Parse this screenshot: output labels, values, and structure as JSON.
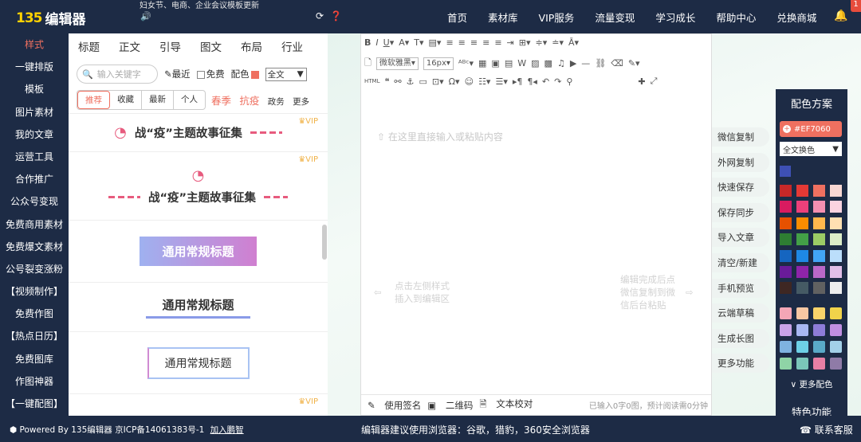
{
  "header": {
    "logo_mark": "135",
    "logo_name": "编辑器",
    "marquee": "妇女节、电商、企业会议模板更新",
    "nav": [
      "首页",
      "素材库",
      "VIP服务",
      "流量变现",
      "学习成长",
      "帮助中心",
      "兑换商城"
    ],
    "notification_count": "1"
  },
  "sidebar": {
    "items": [
      "样式",
      "一键排版",
      "模板",
      "图片素材",
      "我的文章",
      "运营工具",
      "合作推广",
      "公众号变现",
      "免费商用素材",
      "免费爆文素材",
      "公号裂变涨粉",
      "【视频制作】",
      "免费作图",
      "【热点日历】",
      "免费图库",
      "作图神器",
      "【一键配图】"
    ]
  },
  "style_panel": {
    "tabs": [
      "标题",
      "正文",
      "引导",
      "图文",
      "布局",
      "行业"
    ],
    "search_placeholder": "输入关键字",
    "recent_label": "最近",
    "free_label": "免费",
    "color_label": "配色",
    "scope_select": "全文",
    "filters": [
      "推荐",
      "收藏",
      "最新",
      "个人"
    ],
    "extra_filters": [
      "春季",
      "抗疫",
      "政务",
      "更多"
    ],
    "vip_label": "VIP",
    "cards": [
      {
        "title": "战“疫”主题故事征集"
      },
      {
        "title": "战“疫”主题故事征集"
      },
      {
        "title": "通用常规标题"
      },
      {
        "title": "通用常规标题"
      },
      {
        "title": "通用常规标题"
      }
    ]
  },
  "editor": {
    "font_family": "微软雅黑",
    "font_size": "16px",
    "placeholder": "在这里直接输入或粘贴内容",
    "hint_left": [
      "点击左侧样式",
      "插入到编辑区"
    ],
    "hint_right": [
      "编辑完成后点",
      "微信复制到微",
      "信后台粘贴"
    ],
    "footer": {
      "signature": "使用签名",
      "qrcode": "二维码",
      "proofread": "文本校对",
      "count": "已输入0字0图，预计阅读需0分钟"
    }
  },
  "actions": [
    "微信复制",
    "外网复制",
    "快速保存",
    "保存同步",
    "导入文章",
    "清空/新建",
    "手机预览",
    "云端草稿",
    "生成长图",
    "更多功能"
  ],
  "color_panel": {
    "title": "配色方案",
    "current_hex": "#EF7060",
    "scope": "全文换色",
    "current_color": "#3e50b4",
    "palette": [
      "#c62828",
      "#e53935",
      "#ef7060",
      "#f8d7d3",
      "#d81b60",
      "#ec407a",
      "#f48fb1",
      "#fbd3e0",
      "#e65100",
      "#fb8c00",
      "#ffb74d",
      "#ffe0b2",
      "#2e7d32",
      "#43a047",
      "#9ccc65",
      "#dcedc8",
      "#1565c0",
      "#1e88e5",
      "#42a5f5",
      "#bbdefb",
      "#6a1b9a",
      "#8e24aa",
      "#ba68c8",
      "#e1bee7",
      "#3e2723",
      "#455a64",
      "#616161",
      "#eeeeee"
    ],
    "palette2": [
      "#f4a6b6",
      "#f7c7a3",
      "#f9d36a",
      "#f1d34a",
      "#c9a3e8",
      "#a9b7f2",
      "#8e7cd8",
      "#c08ee0",
      "#7fb3e0",
      "#6dd0e6",
      "#5aa9c8",
      "#a3d0e8",
      "#8fd4a6",
      "#7bc6b9",
      "#e77fa5",
      "#8f7ba7"
    ],
    "more_colors": "更多配色",
    "features": "特色功能"
  },
  "footer": {
    "powered": "Powered By 135编辑器",
    "icp": "京ICP备14061383号-1",
    "join": "加入鹏智",
    "browser_tip": "编辑器建议使用浏览器：谷歌，猎豹，360安全浏览器",
    "contact": "联系客服"
  }
}
